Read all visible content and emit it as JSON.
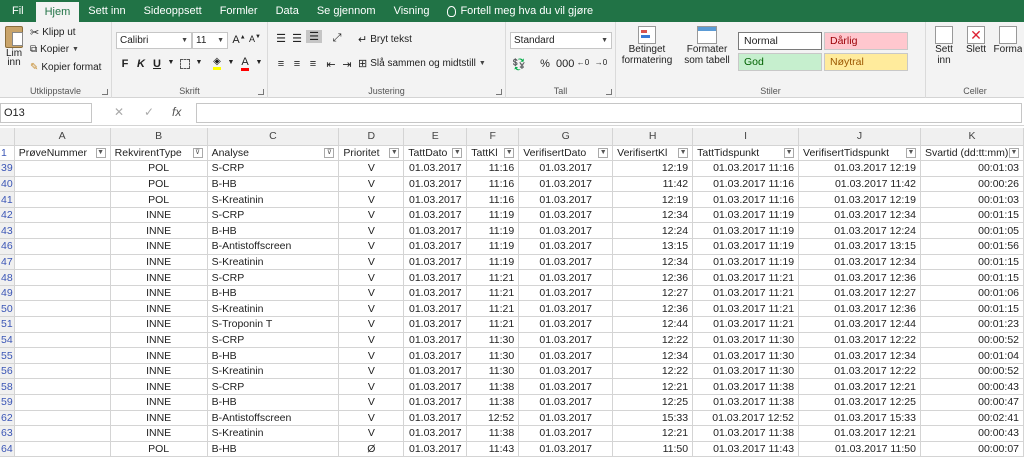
{
  "tabs": [
    "Fil",
    "Hjem",
    "Sett inn",
    "Sideoppsett",
    "Formler",
    "Data",
    "Se gjennom",
    "Visning"
  ],
  "active_tab": "Hjem",
  "tell_me": "Fortell meg hva du vil gjøre",
  "clipboard": {
    "paste": "Lim",
    "paste2": "inn",
    "cut": "Klipp ut",
    "copy": "Kopier",
    "format_painter": "Kopier format",
    "label": "Utklippstavle"
  },
  "font": {
    "name": "Calibri",
    "size": "11",
    "bold": "F",
    "italic": "K",
    "underline": "U",
    "label": "Skrift"
  },
  "alignment": {
    "wrap": "Bryt tekst",
    "merge": "Slå sammen og midtstill",
    "label": "Justering"
  },
  "number": {
    "format": "Standard",
    "label": "Tall"
  },
  "styles": {
    "conditional": "Betinget",
    "conditional2": "formatering",
    "table": "Formater",
    "table2": "som tabell",
    "normal": "Normal",
    "bad": "Dårlig",
    "good": "God",
    "neutral": "Nøytral",
    "label": "Stiler"
  },
  "cells": {
    "insert": "Sett",
    "insert2": "inn",
    "delete": "Slett",
    "format": "Forma",
    "label": "Celler"
  },
  "formula_bar": {
    "name_box": "O13",
    "formula": ""
  },
  "columns": [
    "A",
    "B",
    "C",
    "D",
    "E",
    "F",
    "G",
    "H",
    "I",
    "J",
    "K"
  ],
  "header_row_number": "1",
  "headers": [
    "PrøveNummer",
    "RekvirentType",
    "Analyse",
    "Prioritet",
    "TattDato",
    "TattKl",
    "VerifisertDato",
    "VerifisertKl",
    "TattTidspunkt",
    "VerifisertTidspunkt",
    "Svartid (dd:tt:mm)"
  ],
  "rows": [
    {
      "n": "39",
      "cells": [
        "",
        "POL",
        "S-CRP",
        "V",
        "01.03.2017",
        "11:16",
        "01.03.2017",
        "12:19",
        "01.03.2017 11:16",
        "01.03.2017 12:19",
        "00:01:03"
      ]
    },
    {
      "n": "40",
      "cells": [
        "",
        "POL",
        "B-HB",
        "V",
        "01.03.2017",
        "11:16",
        "01.03.2017",
        "11:42",
        "01.03.2017 11:16",
        "01.03.2017 11:42",
        "00:00:26"
      ]
    },
    {
      "n": "41",
      "cells": [
        "",
        "POL",
        "S-Kreatinin",
        "V",
        "01.03.2017",
        "11:16",
        "01.03.2017",
        "12:19",
        "01.03.2017 11:16",
        "01.03.2017 12:19",
        "00:01:03"
      ]
    },
    {
      "n": "42",
      "cells": [
        "",
        "INNE",
        "S-CRP",
        "V",
        "01.03.2017",
        "11:19",
        "01.03.2017",
        "12:34",
        "01.03.2017 11:19",
        "01.03.2017 12:34",
        "00:01:15"
      ]
    },
    {
      "n": "43",
      "cells": [
        "",
        "INNE",
        "B-HB",
        "V",
        "01.03.2017",
        "11:19",
        "01.03.2017",
        "12:24",
        "01.03.2017 11:19",
        "01.03.2017 12:24",
        "00:01:05"
      ]
    },
    {
      "n": "46",
      "cells": [
        "",
        "INNE",
        "B-Antistoffscreen",
        "V",
        "01.03.2017",
        "11:19",
        "01.03.2017",
        "13:15",
        "01.03.2017 11:19",
        "01.03.2017 13:15",
        "00:01:56"
      ]
    },
    {
      "n": "47",
      "cells": [
        "",
        "INNE",
        "S-Kreatinin",
        "V",
        "01.03.2017",
        "11:19",
        "01.03.2017",
        "12:34",
        "01.03.2017 11:19",
        "01.03.2017 12:34",
        "00:01:15"
      ]
    },
    {
      "n": "48",
      "cells": [
        "",
        "INNE",
        "S-CRP",
        "V",
        "01.03.2017",
        "11:21",
        "01.03.2017",
        "12:36",
        "01.03.2017 11:21",
        "01.03.2017 12:36",
        "00:01:15"
      ]
    },
    {
      "n": "49",
      "cells": [
        "",
        "INNE",
        "B-HB",
        "V",
        "01.03.2017",
        "11:21",
        "01.03.2017",
        "12:27",
        "01.03.2017 11:21",
        "01.03.2017 12:27",
        "00:01:06"
      ]
    },
    {
      "n": "50",
      "cells": [
        "",
        "INNE",
        "S-Kreatinin",
        "V",
        "01.03.2017",
        "11:21",
        "01.03.2017",
        "12:36",
        "01.03.2017 11:21",
        "01.03.2017 12:36",
        "00:01:15"
      ]
    },
    {
      "n": "51",
      "cells": [
        "",
        "INNE",
        "S-Troponin T",
        "V",
        "01.03.2017",
        "11:21",
        "01.03.2017",
        "12:44",
        "01.03.2017 11:21",
        "01.03.2017 12:44",
        "00:01:23"
      ]
    },
    {
      "n": "54",
      "cells": [
        "",
        "INNE",
        "S-CRP",
        "V",
        "01.03.2017",
        "11:30",
        "01.03.2017",
        "12:22",
        "01.03.2017 11:30",
        "01.03.2017 12:22",
        "00:00:52"
      ]
    },
    {
      "n": "55",
      "cells": [
        "",
        "INNE",
        "B-HB",
        "V",
        "01.03.2017",
        "11:30",
        "01.03.2017",
        "12:34",
        "01.03.2017 11:30",
        "01.03.2017 12:34",
        "00:01:04"
      ]
    },
    {
      "n": "56",
      "cells": [
        "",
        "INNE",
        "S-Kreatinin",
        "V",
        "01.03.2017",
        "11:30",
        "01.03.2017",
        "12:22",
        "01.03.2017 11:30",
        "01.03.2017 12:22",
        "00:00:52"
      ]
    },
    {
      "n": "58",
      "cells": [
        "",
        "INNE",
        "S-CRP",
        "V",
        "01.03.2017",
        "11:38",
        "01.03.2017",
        "12:21",
        "01.03.2017 11:38",
        "01.03.2017 12:21",
        "00:00:43"
      ]
    },
    {
      "n": "59",
      "cells": [
        "",
        "INNE",
        "B-HB",
        "V",
        "01.03.2017",
        "11:38",
        "01.03.2017",
        "12:25",
        "01.03.2017 11:38",
        "01.03.2017 12:25",
        "00:00:47"
      ]
    },
    {
      "n": "62",
      "cells": [
        "",
        "INNE",
        "B-Antistoffscreen",
        "V",
        "01.03.2017",
        "12:52",
        "01.03.2017",
        "15:33",
        "01.03.2017 12:52",
        "01.03.2017 15:33",
        "00:02:41"
      ]
    },
    {
      "n": "63",
      "cells": [
        "",
        "INNE",
        "S-Kreatinin",
        "V",
        "01.03.2017",
        "11:38",
        "01.03.2017",
        "12:21",
        "01.03.2017 11:38",
        "01.03.2017 12:21",
        "00:00:43"
      ]
    },
    {
      "n": "64",
      "cells": [
        "",
        "POL",
        "B-HB",
        "Ø",
        "01.03.2017",
        "11:43",
        "01.03.2017",
        "11:50",
        "01.03.2017 11:43",
        "01.03.2017 11:50",
        "00:00:07"
      ]
    }
  ],
  "colors": {
    "ribbon_green": "#217346",
    "bad_fill": "#ffc7ce",
    "bad_text": "#9c0006",
    "good_fill": "#c6efce",
    "good_text": "#006100",
    "neutral_fill": "#ffeb9c",
    "neutral_text": "#9c5700"
  }
}
